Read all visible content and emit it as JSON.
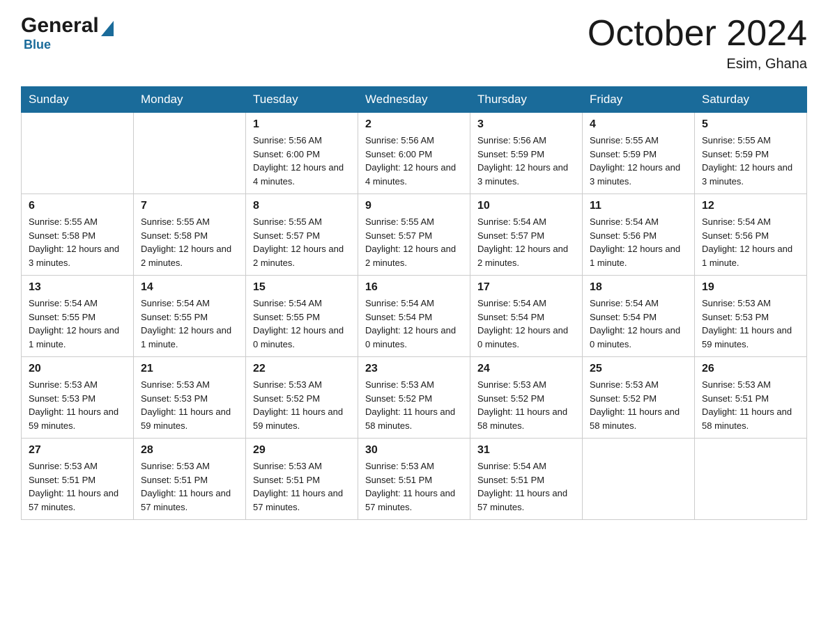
{
  "logo": {
    "text_general": "General",
    "text_blue": "Blue",
    "triangle_color": "#1a6b9a"
  },
  "header": {
    "month_title": "October 2024",
    "location": "Esim, Ghana"
  },
  "weekdays": [
    "Sunday",
    "Monday",
    "Tuesday",
    "Wednesday",
    "Thursday",
    "Friday",
    "Saturday"
  ],
  "weeks": [
    [
      {
        "day": "",
        "sunrise": "",
        "sunset": "",
        "daylight": ""
      },
      {
        "day": "",
        "sunrise": "",
        "sunset": "",
        "daylight": ""
      },
      {
        "day": "1",
        "sunrise": "Sunrise: 5:56 AM",
        "sunset": "Sunset: 6:00 PM",
        "daylight": "Daylight: 12 hours and 4 minutes."
      },
      {
        "day": "2",
        "sunrise": "Sunrise: 5:56 AM",
        "sunset": "Sunset: 6:00 PM",
        "daylight": "Daylight: 12 hours and 4 minutes."
      },
      {
        "day": "3",
        "sunrise": "Sunrise: 5:56 AM",
        "sunset": "Sunset: 5:59 PM",
        "daylight": "Daylight: 12 hours and 3 minutes."
      },
      {
        "day": "4",
        "sunrise": "Sunrise: 5:55 AM",
        "sunset": "Sunset: 5:59 PM",
        "daylight": "Daylight: 12 hours and 3 minutes."
      },
      {
        "day": "5",
        "sunrise": "Sunrise: 5:55 AM",
        "sunset": "Sunset: 5:59 PM",
        "daylight": "Daylight: 12 hours and 3 minutes."
      }
    ],
    [
      {
        "day": "6",
        "sunrise": "Sunrise: 5:55 AM",
        "sunset": "Sunset: 5:58 PM",
        "daylight": "Daylight: 12 hours and 3 minutes."
      },
      {
        "day": "7",
        "sunrise": "Sunrise: 5:55 AM",
        "sunset": "Sunset: 5:58 PM",
        "daylight": "Daylight: 12 hours and 2 minutes."
      },
      {
        "day": "8",
        "sunrise": "Sunrise: 5:55 AM",
        "sunset": "Sunset: 5:57 PM",
        "daylight": "Daylight: 12 hours and 2 minutes."
      },
      {
        "day": "9",
        "sunrise": "Sunrise: 5:55 AM",
        "sunset": "Sunset: 5:57 PM",
        "daylight": "Daylight: 12 hours and 2 minutes."
      },
      {
        "day": "10",
        "sunrise": "Sunrise: 5:54 AM",
        "sunset": "Sunset: 5:57 PM",
        "daylight": "Daylight: 12 hours and 2 minutes."
      },
      {
        "day": "11",
        "sunrise": "Sunrise: 5:54 AM",
        "sunset": "Sunset: 5:56 PM",
        "daylight": "Daylight: 12 hours and 1 minute."
      },
      {
        "day": "12",
        "sunrise": "Sunrise: 5:54 AM",
        "sunset": "Sunset: 5:56 PM",
        "daylight": "Daylight: 12 hours and 1 minute."
      }
    ],
    [
      {
        "day": "13",
        "sunrise": "Sunrise: 5:54 AM",
        "sunset": "Sunset: 5:55 PM",
        "daylight": "Daylight: 12 hours and 1 minute."
      },
      {
        "day": "14",
        "sunrise": "Sunrise: 5:54 AM",
        "sunset": "Sunset: 5:55 PM",
        "daylight": "Daylight: 12 hours and 1 minute."
      },
      {
        "day": "15",
        "sunrise": "Sunrise: 5:54 AM",
        "sunset": "Sunset: 5:55 PM",
        "daylight": "Daylight: 12 hours and 0 minutes."
      },
      {
        "day": "16",
        "sunrise": "Sunrise: 5:54 AM",
        "sunset": "Sunset: 5:54 PM",
        "daylight": "Daylight: 12 hours and 0 minutes."
      },
      {
        "day": "17",
        "sunrise": "Sunrise: 5:54 AM",
        "sunset": "Sunset: 5:54 PM",
        "daylight": "Daylight: 12 hours and 0 minutes."
      },
      {
        "day": "18",
        "sunrise": "Sunrise: 5:54 AM",
        "sunset": "Sunset: 5:54 PM",
        "daylight": "Daylight: 12 hours and 0 minutes."
      },
      {
        "day": "19",
        "sunrise": "Sunrise: 5:53 AM",
        "sunset": "Sunset: 5:53 PM",
        "daylight": "Daylight: 11 hours and 59 minutes."
      }
    ],
    [
      {
        "day": "20",
        "sunrise": "Sunrise: 5:53 AM",
        "sunset": "Sunset: 5:53 PM",
        "daylight": "Daylight: 11 hours and 59 minutes."
      },
      {
        "day": "21",
        "sunrise": "Sunrise: 5:53 AM",
        "sunset": "Sunset: 5:53 PM",
        "daylight": "Daylight: 11 hours and 59 minutes."
      },
      {
        "day": "22",
        "sunrise": "Sunrise: 5:53 AM",
        "sunset": "Sunset: 5:52 PM",
        "daylight": "Daylight: 11 hours and 59 minutes."
      },
      {
        "day": "23",
        "sunrise": "Sunrise: 5:53 AM",
        "sunset": "Sunset: 5:52 PM",
        "daylight": "Daylight: 11 hours and 58 minutes."
      },
      {
        "day": "24",
        "sunrise": "Sunrise: 5:53 AM",
        "sunset": "Sunset: 5:52 PM",
        "daylight": "Daylight: 11 hours and 58 minutes."
      },
      {
        "day": "25",
        "sunrise": "Sunrise: 5:53 AM",
        "sunset": "Sunset: 5:52 PM",
        "daylight": "Daylight: 11 hours and 58 minutes."
      },
      {
        "day": "26",
        "sunrise": "Sunrise: 5:53 AM",
        "sunset": "Sunset: 5:51 PM",
        "daylight": "Daylight: 11 hours and 58 minutes."
      }
    ],
    [
      {
        "day": "27",
        "sunrise": "Sunrise: 5:53 AM",
        "sunset": "Sunset: 5:51 PM",
        "daylight": "Daylight: 11 hours and 57 minutes."
      },
      {
        "day": "28",
        "sunrise": "Sunrise: 5:53 AM",
        "sunset": "Sunset: 5:51 PM",
        "daylight": "Daylight: 11 hours and 57 minutes."
      },
      {
        "day": "29",
        "sunrise": "Sunrise: 5:53 AM",
        "sunset": "Sunset: 5:51 PM",
        "daylight": "Daylight: 11 hours and 57 minutes."
      },
      {
        "day": "30",
        "sunrise": "Sunrise: 5:53 AM",
        "sunset": "Sunset: 5:51 PM",
        "daylight": "Daylight: 11 hours and 57 minutes."
      },
      {
        "day": "31",
        "sunrise": "Sunrise: 5:54 AM",
        "sunset": "Sunset: 5:51 PM",
        "daylight": "Daylight: 11 hours and 57 minutes."
      },
      {
        "day": "",
        "sunrise": "",
        "sunset": "",
        "daylight": ""
      },
      {
        "day": "",
        "sunrise": "",
        "sunset": "",
        "daylight": ""
      }
    ]
  ]
}
